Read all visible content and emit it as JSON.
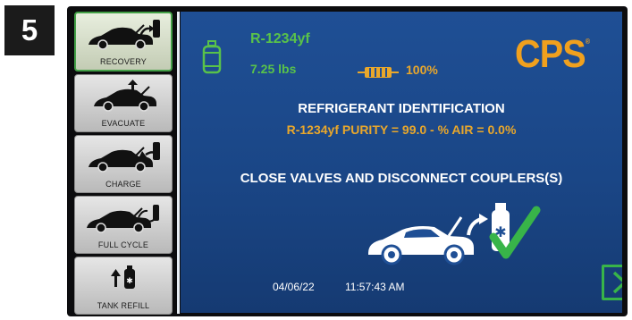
{
  "step_number": "5",
  "sidebar": {
    "items": [
      {
        "label": "RECOVERY",
        "icon": "car-recovery-icon",
        "active": true
      },
      {
        "label": "EVACUATE",
        "icon": "car-evacuate-icon",
        "active": false
      },
      {
        "label": "CHARGE",
        "icon": "car-charge-icon",
        "active": false
      },
      {
        "label": "FULL CYCLE",
        "icon": "car-full-cycle-icon",
        "active": false
      },
      {
        "label": "TANK REFILL",
        "icon": "tank-refill-icon",
        "active": false
      }
    ]
  },
  "status": {
    "refrigerant": "R-1234yf",
    "weight": "7.25 lbs",
    "battery": "100%"
  },
  "brand": {
    "logo": "CPS",
    "registered_mark": "®"
  },
  "main": {
    "title": "REFRIGERANT IDENTIFICATION",
    "purity_line": "R-1234yf PURITY = 99.0 - % AIR = 0.0%",
    "instruction": "CLOSE VALVES AND DISCONNECT COUPLERS(S)"
  },
  "footer": {
    "date": "04/06/22",
    "time": "11:57:43 AM"
  },
  "colors": {
    "accent_green": "#59c24a",
    "accent_orange": "#e9a72b",
    "screen_blue": "#1f4f95",
    "check_green": "#38b449"
  }
}
